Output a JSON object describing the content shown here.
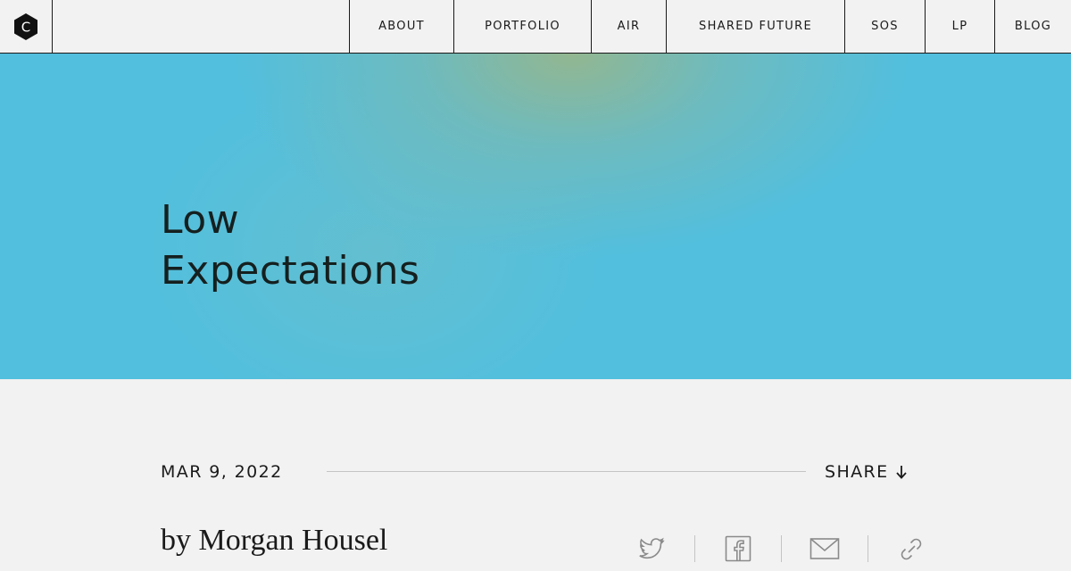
{
  "nav": {
    "logo_letter": "C",
    "items": [
      {
        "id": "about",
        "label": "ABOUT"
      },
      {
        "id": "portfolio",
        "label": "PORTFOLIO"
      },
      {
        "id": "air",
        "label": "AIR"
      },
      {
        "id": "shared-future",
        "label": "SHARED FUTURE"
      },
      {
        "id": "sos",
        "label": "SOS"
      },
      {
        "id": "lp",
        "label": "LP"
      },
      {
        "id": "blog",
        "label": "BLOG"
      }
    ]
  },
  "hero": {
    "title_line1": "Low",
    "title_line2": "Expectations"
  },
  "article": {
    "date": "MAR 9, 2022",
    "share_label": "SHARE",
    "byline": "by Morgan Housel"
  },
  "share_icons": [
    "twitter-icon",
    "facebook-icon",
    "mail-icon",
    "link-icon"
  ],
  "colors": {
    "hero_blue": "#52bfde",
    "hero_green_glow": "#96b68c",
    "page_background": "#f2f2f2",
    "text": "#1a1a1a"
  }
}
